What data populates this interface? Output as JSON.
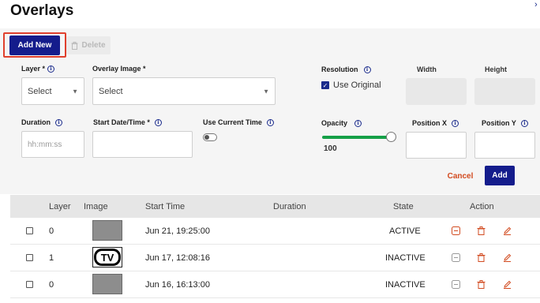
{
  "page": {
    "title": "Overlays",
    "close_icon": "chevron-right-icon"
  },
  "toolbar": {
    "add_new_label": "Add New",
    "delete_label": "Delete"
  },
  "form": {
    "layer": {
      "label": "Layer *",
      "value": "Select"
    },
    "overlay_image": {
      "label": "Overlay Image *",
      "value": "Select"
    },
    "resolution": {
      "label": "Resolution",
      "use_original_label": "Use Original",
      "use_original_checked": true
    },
    "width": {
      "label": "Width",
      "value": ""
    },
    "height": {
      "label": "Height",
      "value": ""
    },
    "duration": {
      "label": "Duration",
      "placeholder": "hh:mm:ss"
    },
    "start_datetime": {
      "label": "Start Date/Time *",
      "value": ""
    },
    "use_current_time": {
      "label": "Use Current Time",
      "enabled": false
    },
    "opacity": {
      "label": "Opacity",
      "value": "100",
      "fraction": 1.0
    },
    "position_x": {
      "label": "Position X",
      "value": ""
    },
    "position_y": {
      "label": "Position Y",
      "value": ""
    },
    "cancel_label": "Cancel",
    "add_label": "Add"
  },
  "table": {
    "columns": [
      "Layer",
      "Image",
      "Start Time",
      "Duration",
      "State",
      "Action"
    ],
    "rows": [
      {
        "layer": "0",
        "image": "grey-thumbnail",
        "start_time": "Jun 21, 19:25:00",
        "duration": "",
        "state": "ACTIVE"
      },
      {
        "layer": "1",
        "image": "tv-logo-thumbnail",
        "start_time": "Jun 17, 12:08:16",
        "duration": "",
        "state": "INACTIVE"
      },
      {
        "layer": "0",
        "image": "grey-thumbnail",
        "start_time": "Jun 16, 16:13:00",
        "duration": "",
        "state": "INACTIVE"
      }
    ]
  },
  "colors": {
    "primary": "#141c8c",
    "accent_red": "#e0402d",
    "slider_green": "#15a047",
    "action_orange": "#d24b20"
  }
}
